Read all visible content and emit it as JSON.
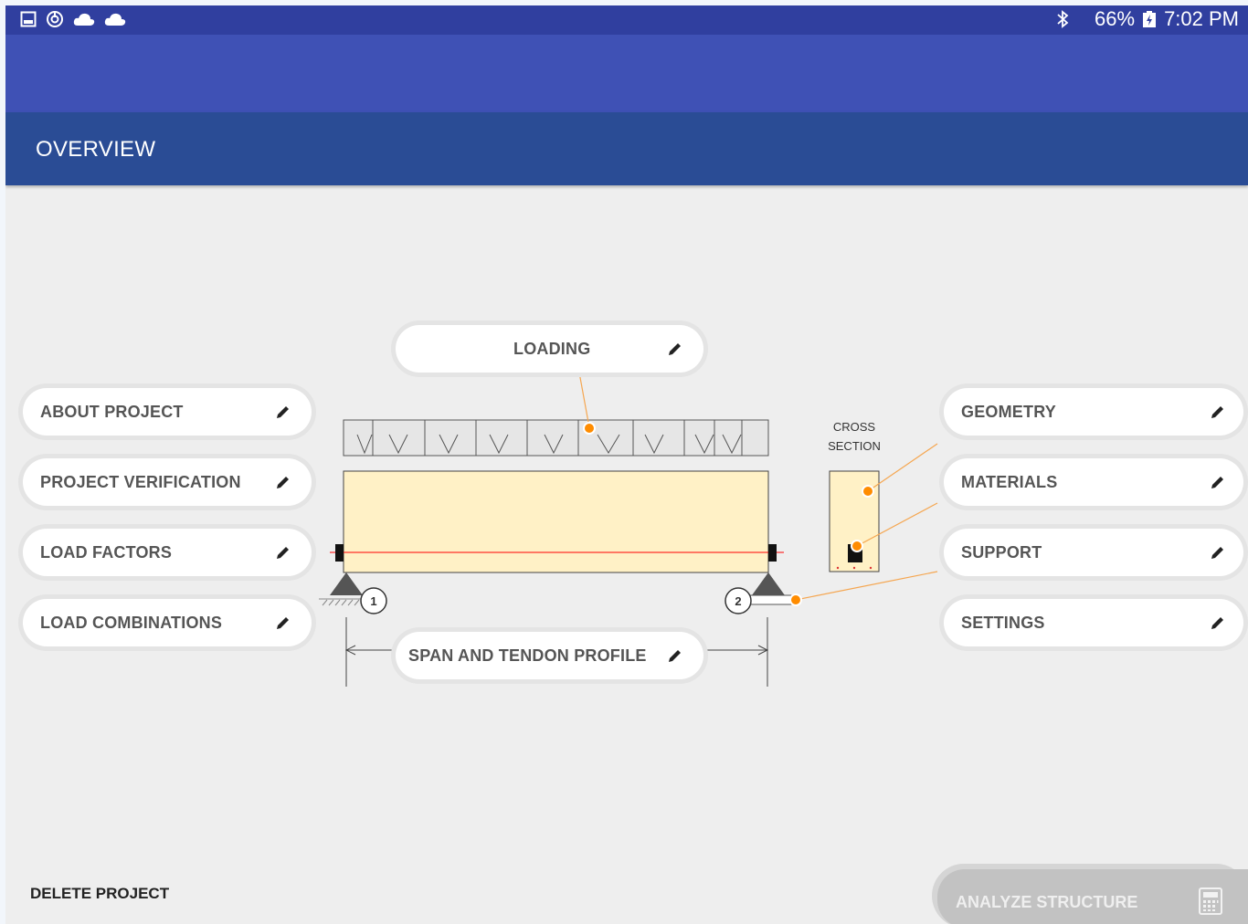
{
  "statusbar": {
    "battery": "66%",
    "time": "7:02 PM",
    "icons_left": [
      "gallery-icon",
      "sync-icon",
      "cloud-icon",
      "cloud-icon"
    ],
    "icons_right": [
      "bluetooth-icon",
      "battery-charging-icon"
    ]
  },
  "header": {
    "title": "OVERVIEW"
  },
  "buttons": {
    "about_project": "ABOUT PROJECT",
    "project_verification": "PROJECT VERIFICATION",
    "load_factors": "LOAD FACTORS",
    "load_combinations": "LOAD COMBINATIONS",
    "loading": "LOADING",
    "span_tendon": "SPAN AND TENDON PROFILE",
    "geometry": "GEOMETRY",
    "materials": "MATERIALS",
    "support": "SUPPORT",
    "settings": "SETTINGS"
  },
  "diagram": {
    "cross_section_line1": "CROSS",
    "cross_section_line2": "SECTION",
    "support_1": "1",
    "support_2": "2"
  },
  "footer": {
    "delete": "DELETE PROJECT",
    "analyze": "ANALYZE STRUCTURE"
  },
  "colors": {
    "status_bar": "#303f9f",
    "app_bar": "#3f51b5",
    "tab_bar": "#2a4c95",
    "beam_fill": "#fff1c6",
    "callout": "#ff8c00",
    "tendon": "#ff0000"
  }
}
